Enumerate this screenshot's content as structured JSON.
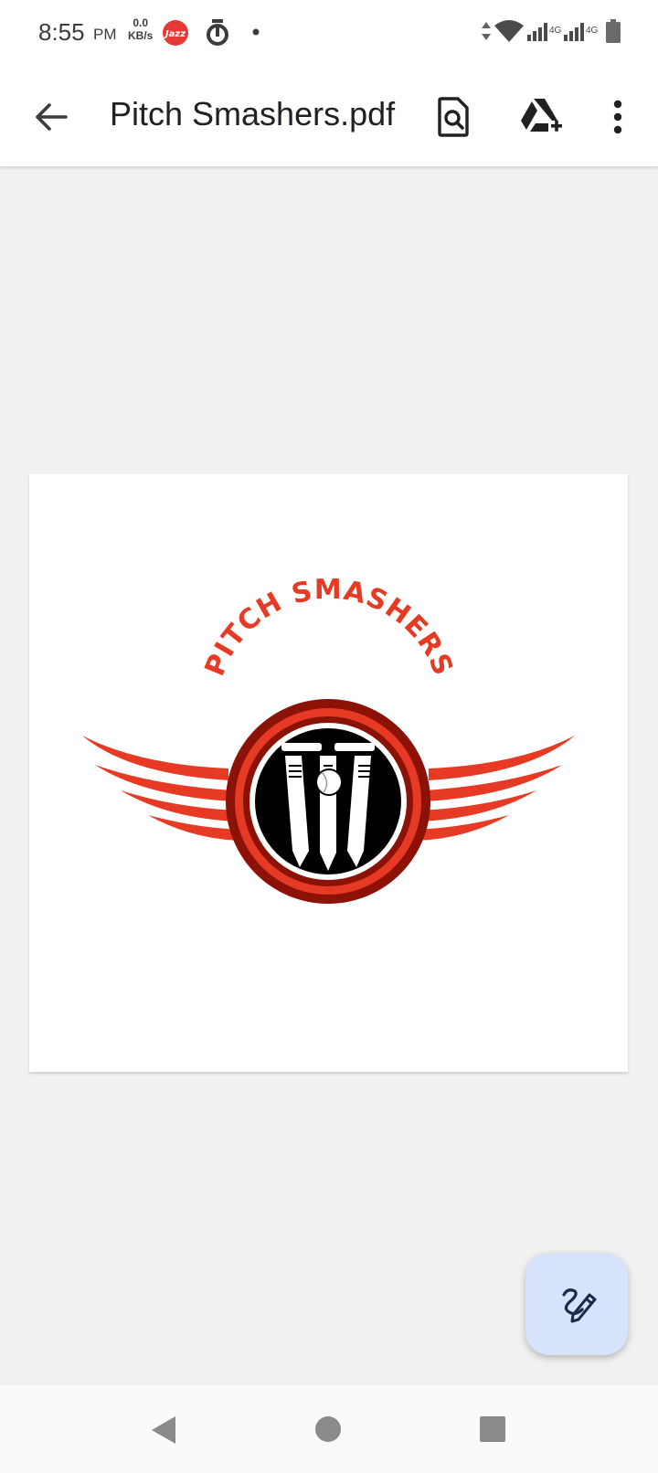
{
  "status_bar": {
    "time": "8:55",
    "ampm": "PM",
    "speed_value": "0.0",
    "speed_unit": "KB/s",
    "carrier_badge": "Jazz",
    "network_label_1": "4G",
    "network_label_2": "4G"
  },
  "app_bar": {
    "title": "Pitch Smashers.pdf",
    "icons": [
      "back-arrow-icon",
      "find-in-page-icon",
      "add-to-drive-icon",
      "more-vert-icon"
    ]
  },
  "document": {
    "logo_text": "PITCH SMASHERS",
    "colors": {
      "primary_red": "#e63a24",
      "dark_red": "#8c1208",
      "black": "#000000"
    }
  },
  "fab": {
    "icon": "annotate-pen-icon",
    "color": "#d6e3fb"
  },
  "nav_bar": {
    "icons": [
      "back-triangle-icon",
      "home-circle-icon",
      "recents-square-icon"
    ]
  }
}
